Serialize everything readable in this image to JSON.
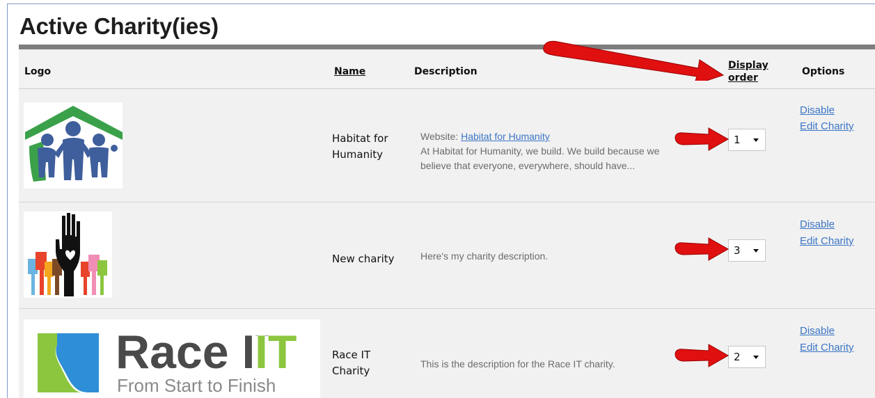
{
  "page": {
    "title": "Active Charity(ies)"
  },
  "table": {
    "headers": {
      "logo": "Logo",
      "name": "Name",
      "description": "Description",
      "display_order_line1": "Display",
      "display_order_line2": "order",
      "options": "Options"
    },
    "rows": [
      {
        "name_line1": "Habitat for",
        "name_line2": "Humanity",
        "website_prefix": "Website: ",
        "website_link": "Habitat for Humanity",
        "desc_line1": "At Habitat for Humanity, we build. We build because we",
        "desc_line2": "believe that everyone, everywhere, should have...",
        "order": "1",
        "disable": "Disable",
        "edit": "Edit Charity"
      },
      {
        "name_line1": "New charity",
        "desc_line1": "Here's my charity description.",
        "order": "3",
        "disable": "Disable",
        "edit": "Edit Charity"
      },
      {
        "name_line1": "Race IT",
        "name_line2": "Charity",
        "desc_line1": "This is the description for the Race IT charity.",
        "order": "2",
        "disable": "Disable",
        "edit": "Edit Charity",
        "logo_text_big": "Race IT",
        "logo_text_small": "From Start to Finish"
      }
    ]
  },
  "colors": {
    "link": "#3b75c4",
    "arrow": "#e01010",
    "habitat_green": "#3aa14a",
    "habitat_blue": "#3e5e9c",
    "raceit_green": "#8cc63f",
    "raceit_blue": "#2e8fd8"
  }
}
